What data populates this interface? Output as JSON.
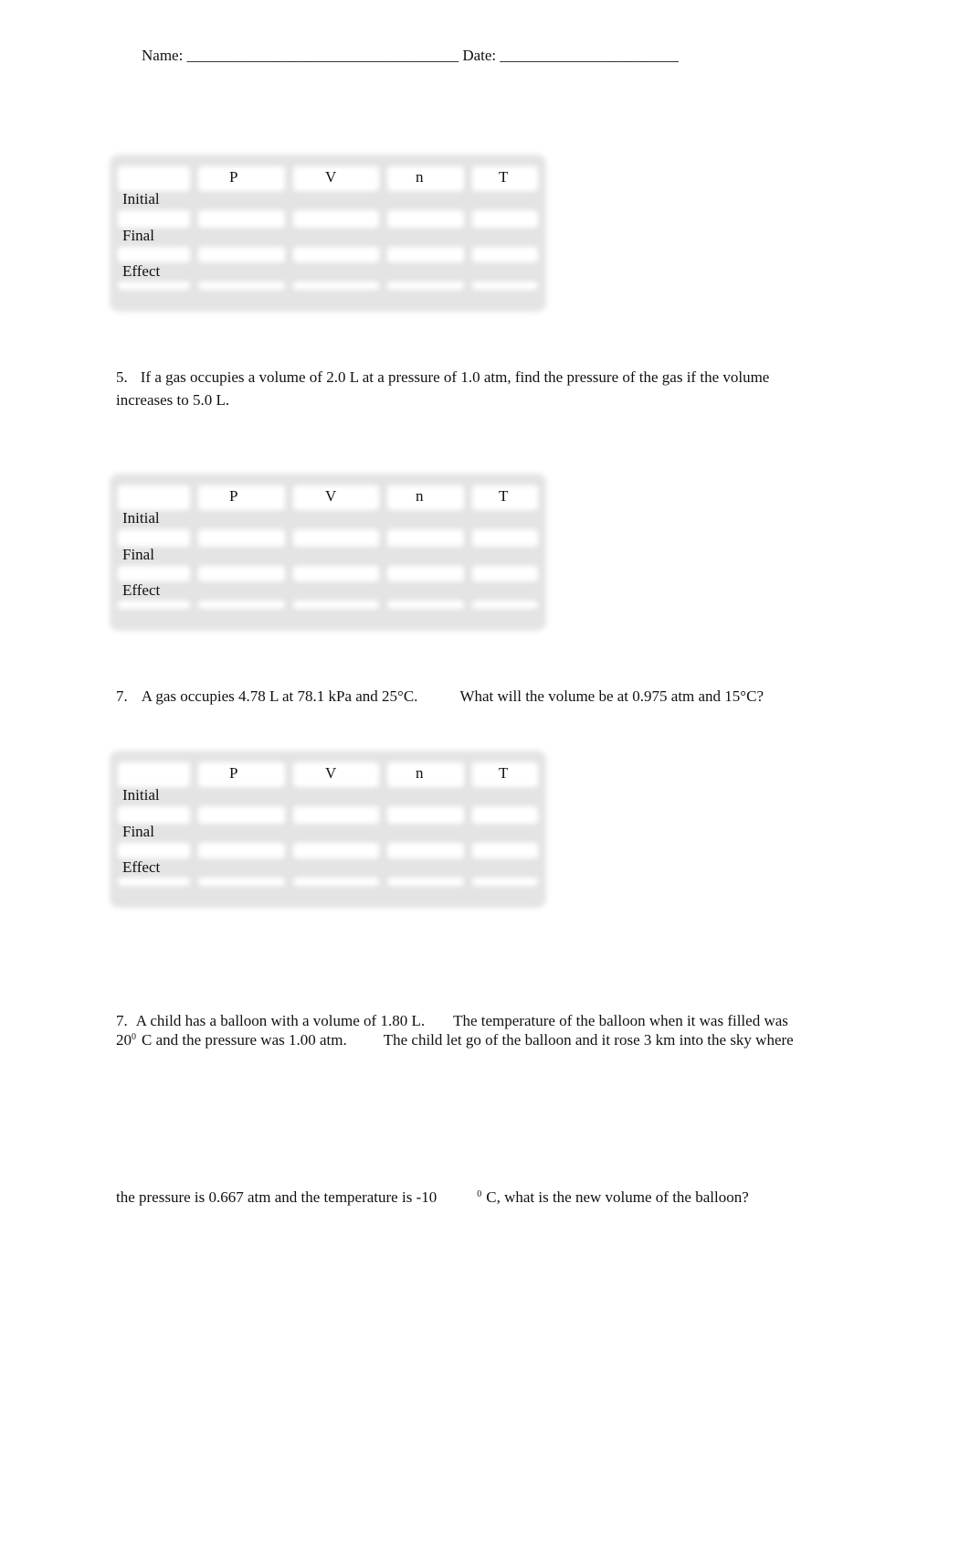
{
  "header": {
    "name_label": "Name:",
    "name_blank": "___________________________________",
    "date_label": "Date:",
    "date_blank": "_______________________"
  },
  "table_template": {
    "columns": [
      "",
      "P",
      "V",
      "n",
      "T"
    ],
    "rows": [
      "Initial",
      "Final",
      "Effect"
    ]
  },
  "tables": [
    {
      "columns": [
        "",
        "P",
        "V",
        "n",
        "T"
      ],
      "rows": [
        "Initial",
        "Final",
        "Effect"
      ]
    },
    {
      "columns": [
        "",
        "P",
        "V",
        "n",
        "T"
      ],
      "rows": [
        "Initial",
        "Final",
        "Effect"
      ]
    },
    {
      "columns": [
        "",
        "P",
        "V",
        "n",
        "T"
      ],
      "rows": [
        "Initial",
        "Final",
        "Effect"
      ]
    }
  ],
  "questions": {
    "q5": {
      "number": "5.",
      "line1": "If a gas occupies a volume of 2.0 L at a pressure of 1.0 atm, find the pressure of the gas if the volume",
      "line2": "increases to 5.0 L."
    },
    "q7a": {
      "number": "7.",
      "part1": "A gas occupies 4.78 L at 78.1 kPa and 25°C.",
      "part2": "What will the volume be at 0.975 atm and 15°C?"
    },
    "q7b": {
      "number": "7.",
      "line1_part1": "A child has a balloon with a volume of 1.80 L.",
      "line1_part2": "The temperature of the balloon when it was filled was",
      "line2_temp": "20",
      "line2_sup": "0",
      "line2_part1": "C and the pressure was 1.00 atm.",
      "line2_part2": "The child let go of the balloon and it rose 3 km into the sky where",
      "line3_part1": "the pressure is 0.667 atm and the temperature is -10",
      "line3_sup": "0",
      "line3_part2": "C, what is the new volume of the balloon?"
    }
  }
}
